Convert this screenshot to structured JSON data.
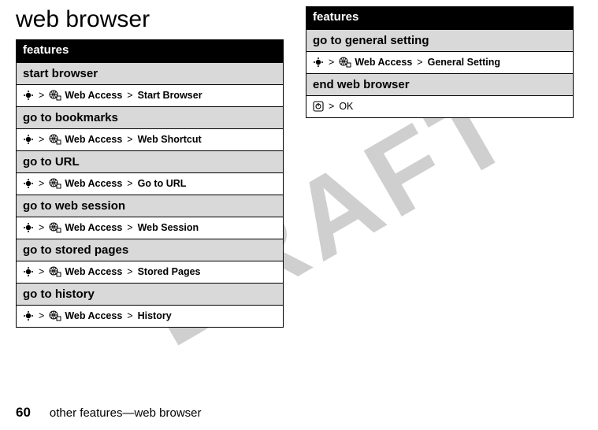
{
  "watermark": "DRAFT",
  "title": "web browser",
  "features_header": "features",
  "left_rows": [
    {
      "title": "start browser",
      "menu": "Web Access",
      "action": "Start Browser"
    },
    {
      "title": "go to bookmarks",
      "menu": "Web Access",
      "action": "Web Shortcut"
    },
    {
      "title": "go to URL",
      "menu": "Web Access",
      "action": "Go to URL"
    },
    {
      "title": "go to web session",
      "menu": "Web Access",
      "action": "Web Session"
    },
    {
      "title": "go to stored pages",
      "menu": "Web Access",
      "action": "Stored Pages"
    },
    {
      "title": "go to history",
      "menu": "Web Access",
      "action": "History"
    }
  ],
  "right_rows": {
    "general": {
      "title": "go to general setting",
      "menu": "Web Access",
      "action": "General Setting"
    },
    "end": {
      "title": "end web browser",
      "action": "OK"
    }
  },
  "separator": ">",
  "footer": {
    "page": "60",
    "text": "other features—web browser"
  }
}
